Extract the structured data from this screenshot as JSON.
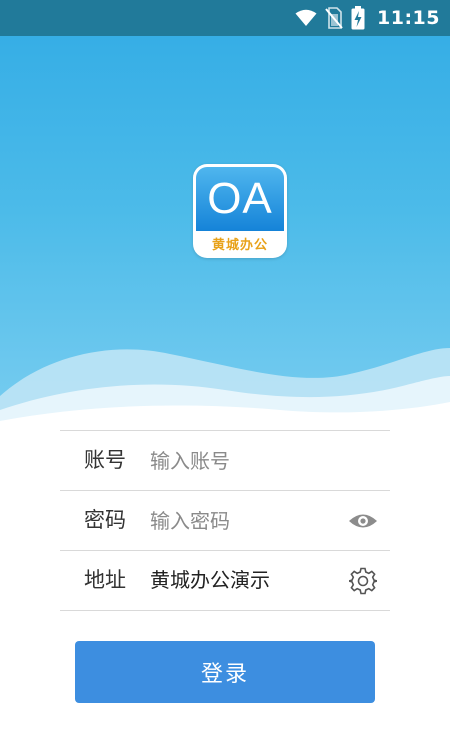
{
  "status_bar": {
    "time": "11:15",
    "icons": [
      "wifi-icon",
      "no-sim-icon",
      "battery-charging-icon"
    ]
  },
  "app": {
    "logo_text": "OA",
    "logo_subtitle": "黄城办公"
  },
  "form": {
    "account": {
      "label": "账号",
      "placeholder": "输入账号",
      "value": ""
    },
    "password": {
      "label": "密码",
      "placeholder": "输入密码",
      "value": "",
      "toggle_icon": "eye-icon"
    },
    "address": {
      "label": "地址",
      "value": "黄城办公演示",
      "settings_icon": "gear-icon"
    }
  },
  "login_button": {
    "label": "登录"
  },
  "colors": {
    "status_bar": "#217a9a",
    "hero_top": "#36aee6",
    "hero_bottom": "#79cdf0",
    "button": "#3d8ee0",
    "logo_subtitle": "#e8a21a"
  }
}
